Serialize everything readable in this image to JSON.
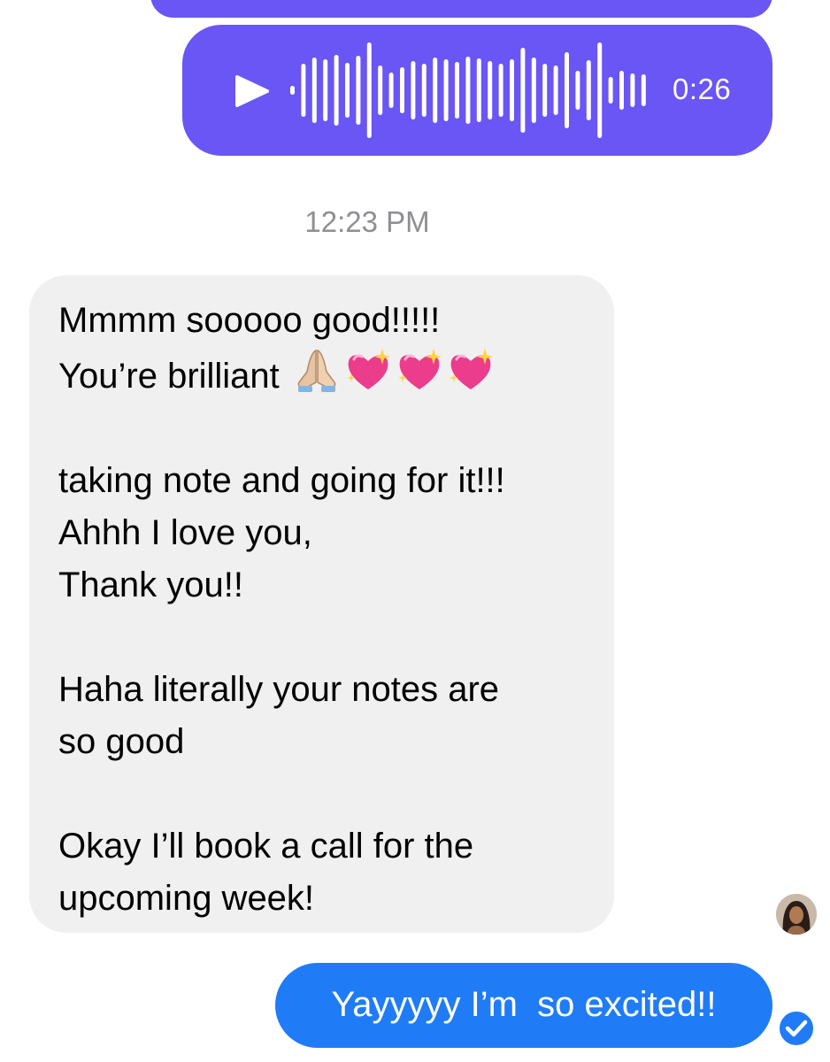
{
  "colors": {
    "voice_bubble": "#6a55f5",
    "sent_bubble": "#1f7cf6",
    "received_bubble": "#f0f0f0",
    "timestamp_text": "#8e8e93"
  },
  "conversation": {
    "voice_message": {
      "duration": "0:26",
      "play_icon": "play-icon"
    },
    "timestamp": "12:23 PM",
    "received_message": {
      "lines": [
        "Mmmm sooooo good!!!!!",
        "You’re brilliant",
        "",
        "taking note and going for it!!!",
        "Ahhh I love you,",
        "Thank you!!",
        "",
        "Haha literally your notes are",
        "so good",
        "",
        "Okay I’ll book a call for the",
        "upcoming week!"
      ],
      "emojis": [
        "folded-hands-icon",
        "sparkling-heart-icon",
        "sparkling-heart-icon",
        "sparkling-heart-icon"
      ]
    },
    "sent_message": {
      "text": "Yayyyyy I’m  so excited!!",
      "status_icon": "read-check-icon"
    }
  }
}
